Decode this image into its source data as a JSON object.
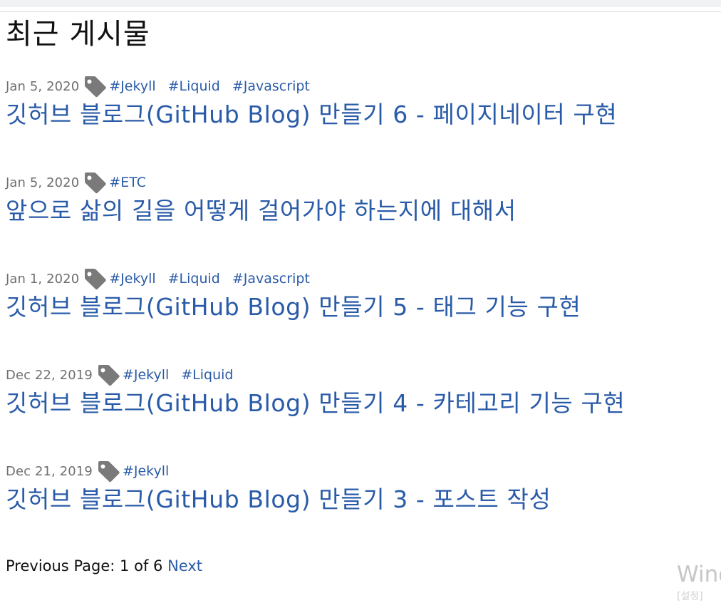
{
  "heading": "최근 게시물",
  "posts": [
    {
      "date": "Jan 5, 2020",
      "tags": [
        "#Jekyll",
        "#Liquid",
        "#Javascript"
      ],
      "title": "깃허브 블로그(GitHub Blog) 만들기 6 - 페이지네이터 구현"
    },
    {
      "date": "Jan 5, 2020",
      "tags": [
        "#ETC"
      ],
      "title": "앞으로 삶의 길을 어떻게 걸어가야 하는지에 대해서"
    },
    {
      "date": "Jan 1, 2020",
      "tags": [
        "#Jekyll",
        "#Liquid",
        "#Javascript"
      ],
      "title": "깃허브 블로그(GitHub Blog) 만들기 5 - 태그 기능 구현"
    },
    {
      "date": "Dec 22, 2019",
      "tags": [
        "#Jekyll",
        "#Liquid"
      ],
      "title": "깃허브 블로그(GitHub Blog) 만들기 4 - 카테고리 기능 구현"
    },
    {
      "date": "Dec 21, 2019",
      "tags": [
        "#Jekyll"
      ],
      "title": "깃허브 블로그(GitHub Blog) 만들기 3 - 포스트 작성"
    }
  ],
  "pagination": {
    "previous_label": "Previous",
    "page_label": "Page:",
    "current_page": "1",
    "of_label": "of",
    "total_pages": "6",
    "next_label": "Next"
  },
  "watermark": {
    "text": "Wind",
    "subtext": "[설정]"
  },
  "icons": {
    "tag": "tag-icon"
  },
  "colors": {
    "link": "#2a5ba8",
    "date": "#6f6f6f",
    "tag_icon": "#7a7a7a",
    "text": "#111111"
  }
}
